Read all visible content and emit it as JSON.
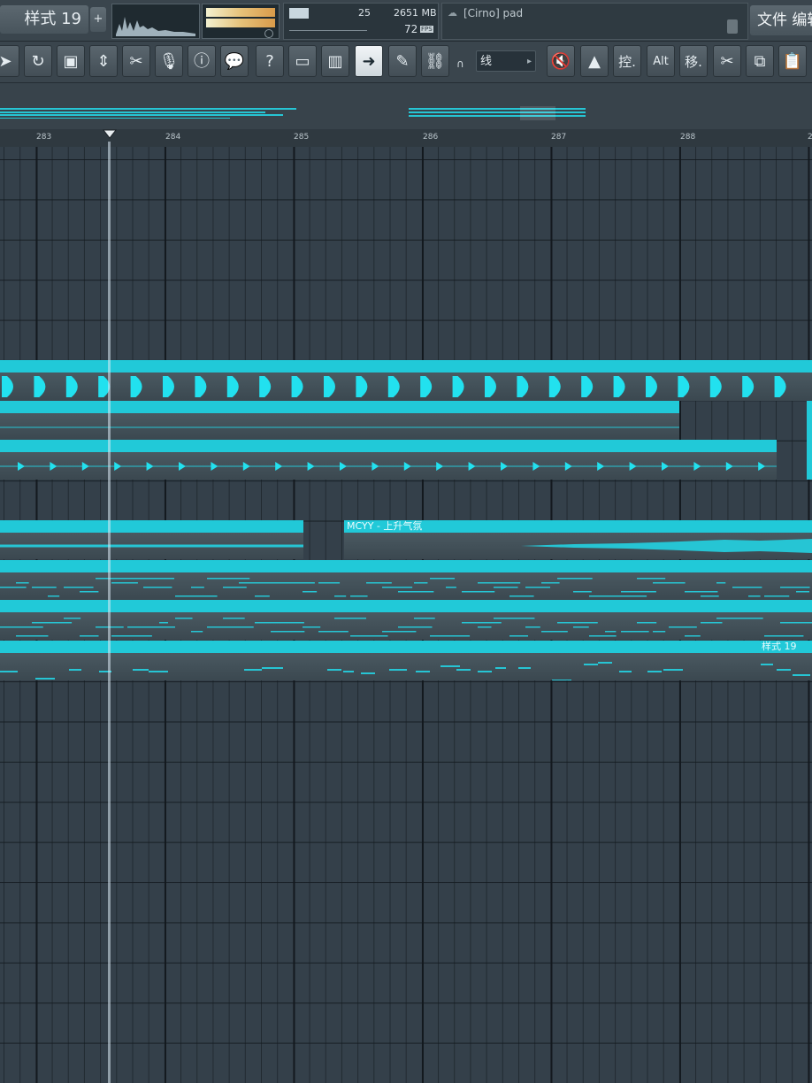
{
  "top": {
    "pattern_label": "样式 19",
    "pattern_add": "+",
    "cpu_value": "25",
    "memory": "2651 MB",
    "polyphony": "72",
    "fps_label": "FPS",
    "hint_text": "[Cirno] pad",
    "menu_label": "文件 编辑"
  },
  "toolbar": {
    "snap_value": "线",
    "btn_control_label": "控.",
    "btn_alt_label": "Alt",
    "btn_move_label": "移.",
    "btn_help_label": "?"
  },
  "ruler": {
    "bars": [
      "283",
      "284",
      "285",
      "286",
      "287",
      "288",
      "2"
    ]
  },
  "clips": {
    "audio_label": "MCYY - 上升气氛",
    "pattern_label": "样式 19"
  },
  "colors": {
    "accent": "#21c9d8",
    "background": "#34404a",
    "toolbar": "#3a454d"
  }
}
